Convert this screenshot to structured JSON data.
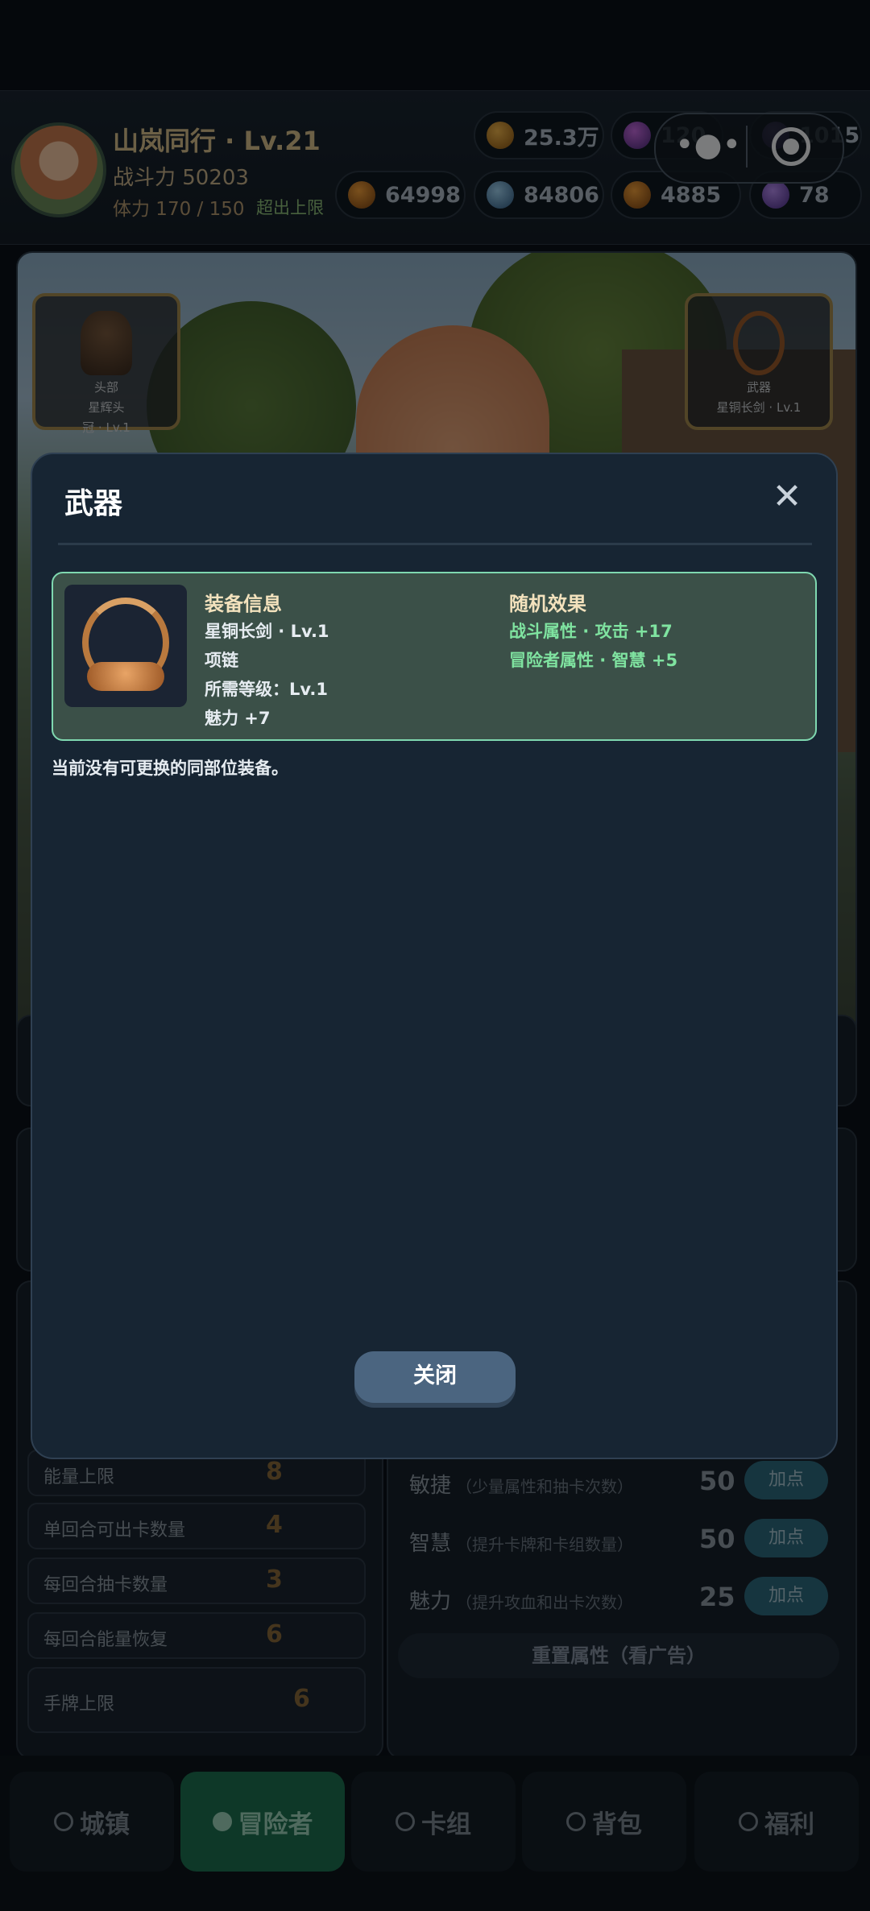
{
  "player": {
    "name": "山岚同行 · Lv.21",
    "power": "战斗力 50203",
    "stamina": "体力 170 / 150",
    "stamina_over": "超出上限"
  },
  "currencies": [
    {
      "icon": "gold-coin-icon",
      "value": "25.3万"
    },
    {
      "icon": "gem-icon",
      "value": "120"
    },
    {
      "icon": "purple-gem-icon",
      "value": "1015"
    },
    {
      "icon": "bread-icon",
      "value": "64998"
    },
    {
      "icon": "crystal-icon",
      "value": "84806"
    },
    {
      "icon": "amber-icon",
      "value": "4885"
    },
    {
      "icon": "purple-orb-icon",
      "value": "78"
    }
  ],
  "miniprogram": {
    "menu": "•●•"
  },
  "scene": {
    "head_slot": {
      "t1": "头部",
      "t2": "星辉头",
      "t3": "冠 · Lv.1"
    },
    "weapon_slot": {
      "t1": "武器",
      "t2": "星铜长剑 · Lv.1"
    }
  },
  "stats_left": [
    {
      "label": "能量上限",
      "value": "8"
    },
    {
      "label": "单回合可出卡数量",
      "value": "4"
    },
    {
      "label": "每回合抽卡数量",
      "value": "3"
    },
    {
      "label": "每回合能量恢复",
      "value": "6"
    },
    {
      "label": "手牌上限",
      "value": "6"
    }
  ],
  "stats_right": [
    {
      "label": "敏捷",
      "desc": "（少量属性和抽卡次数）",
      "value": "50",
      "button": "加点"
    },
    {
      "label": "智慧",
      "desc": "（提升卡牌和卡组数量）",
      "value": "50",
      "button": "加点"
    },
    {
      "label": "魅力",
      "desc": "（提升攻血和出卡次数）",
      "value": "25",
      "button": "加点"
    }
  ],
  "reset_button": "重置属性（看广告）",
  "nav": [
    {
      "label": "城镇",
      "active": false
    },
    {
      "label": "冒险者",
      "active": true
    },
    {
      "label": "卡组",
      "active": false
    },
    {
      "label": "背包",
      "active": false
    },
    {
      "label": "福利",
      "active": false
    }
  ],
  "modal": {
    "title": "武器",
    "close_icon": "✕",
    "info_header": "装备信息",
    "info_lines": [
      "星铜长剑 · Lv.1",
      "项链",
      "所需等级：Lv.1",
      "魅力 +7"
    ],
    "random_header": "随机效果",
    "random_lines": [
      "战斗属性 · 攻击 +17",
      "冒险者属性 · 智慧 +5"
    ],
    "no_swap_text": "当前没有可更换的同部位装备。",
    "close_button": "关闭"
  },
  "colors": {
    "accent_green": "#1d7050",
    "card_border": "#7fd8b0",
    "random_text": "#7fe3a0",
    "gold_text": "#d9c08d"
  }
}
